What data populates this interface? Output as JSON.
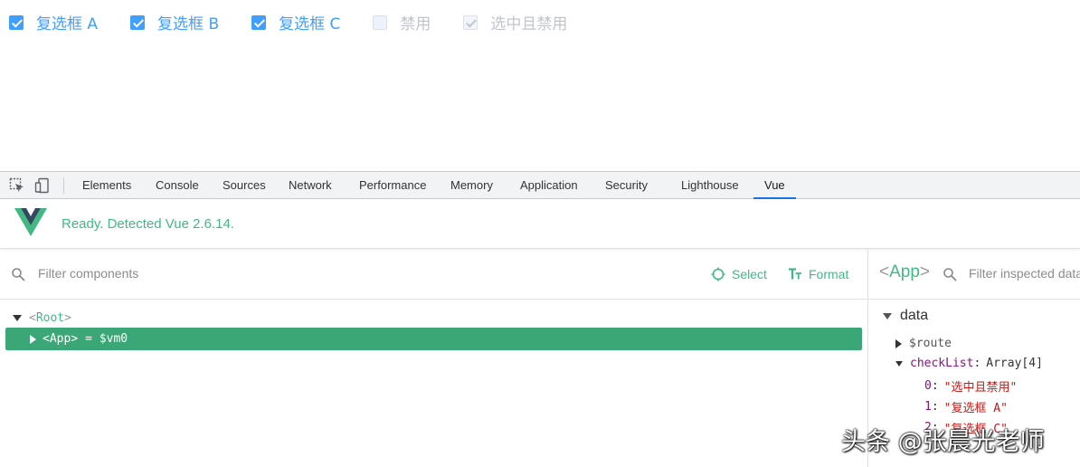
{
  "page": {
    "checkboxes": [
      {
        "label": "复选框 A",
        "state": "checked"
      },
      {
        "label": "复选框 B",
        "state": "checked"
      },
      {
        "label": "复选框 C",
        "state": "checked"
      },
      {
        "label": "禁用",
        "state": "disabled"
      },
      {
        "label": "选中且禁用",
        "state": "disabled-checked"
      }
    ]
  },
  "devtools": {
    "tabs": [
      "Elements",
      "Console",
      "Sources",
      "Network",
      "Performance",
      "Memory",
      "Application",
      "Security",
      "Lighthouse",
      "Vue"
    ],
    "active_tab": "Vue"
  },
  "vue": {
    "banner": "Ready. Detected Vue 2.6.14.",
    "filter_placeholder": "Filter components",
    "select_label": "Select",
    "format_label": "Format",
    "tree": {
      "root": "Root",
      "app": "App",
      "app_suffix": "= $vm0"
    },
    "inspector": {
      "title": "App",
      "filter_placeholder": "Filter inspected data",
      "section": "data",
      "route_key": "$route",
      "checklist_key": "checkList",
      "checklist_type": "Array[4]",
      "items": [
        {
          "index": "0",
          "value": "\"选中且禁用\""
        },
        {
          "index": "1",
          "value": "\"复选框 A\""
        },
        {
          "index": "2",
          "value": "\"复选框 C\""
        }
      ]
    }
  },
  "watermark": "头条 @张晨光老师",
  "colors": {
    "vue_green": "#42b983",
    "selected_row": "#3ba776",
    "checkbox_blue": "#409eff"
  }
}
